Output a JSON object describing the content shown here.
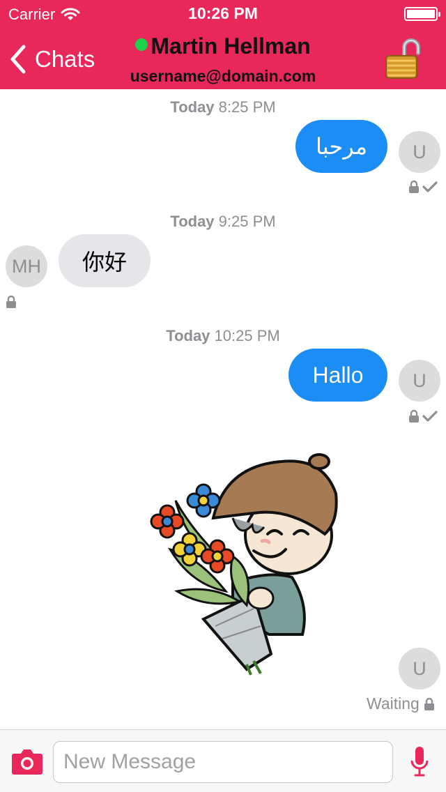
{
  "status_bar": {
    "carrier": "Carrier",
    "time": "10:26 PM"
  },
  "header": {
    "back_label": "Chats",
    "contact_name": "Martin Hellman",
    "contact_email": "username@domain.com",
    "presence": "online",
    "lock_state": "unlocked",
    "colors": {
      "bar": "#e8275a",
      "online": "#1fd04a"
    }
  },
  "messages": [
    {
      "day": "Today",
      "time": "8:25 PM",
      "direction": "outgoing",
      "text": "مرحبا",
      "avatar": "U",
      "encrypted": true,
      "delivered": true
    },
    {
      "day": "Today",
      "time": "9:25 PM",
      "direction": "incoming",
      "text": "你好",
      "avatar": "MH",
      "encrypted": true
    },
    {
      "day": "Today",
      "time": "10:25 PM",
      "direction": "outgoing",
      "text": "Hallo",
      "avatar": "U",
      "encrypted": true,
      "delivered": true
    },
    {
      "direction": "outgoing",
      "type": "sticker",
      "sticker": "boy-with-flowers",
      "avatar": "U",
      "status": "Waiting",
      "encrypted": true
    }
  ],
  "input": {
    "placeholder": "New Message",
    "value": ""
  },
  "colors": {
    "outgoing_bubble": "#1b8df5",
    "incoming_bubble": "#e5e5ea",
    "accent": "#e8275a"
  }
}
